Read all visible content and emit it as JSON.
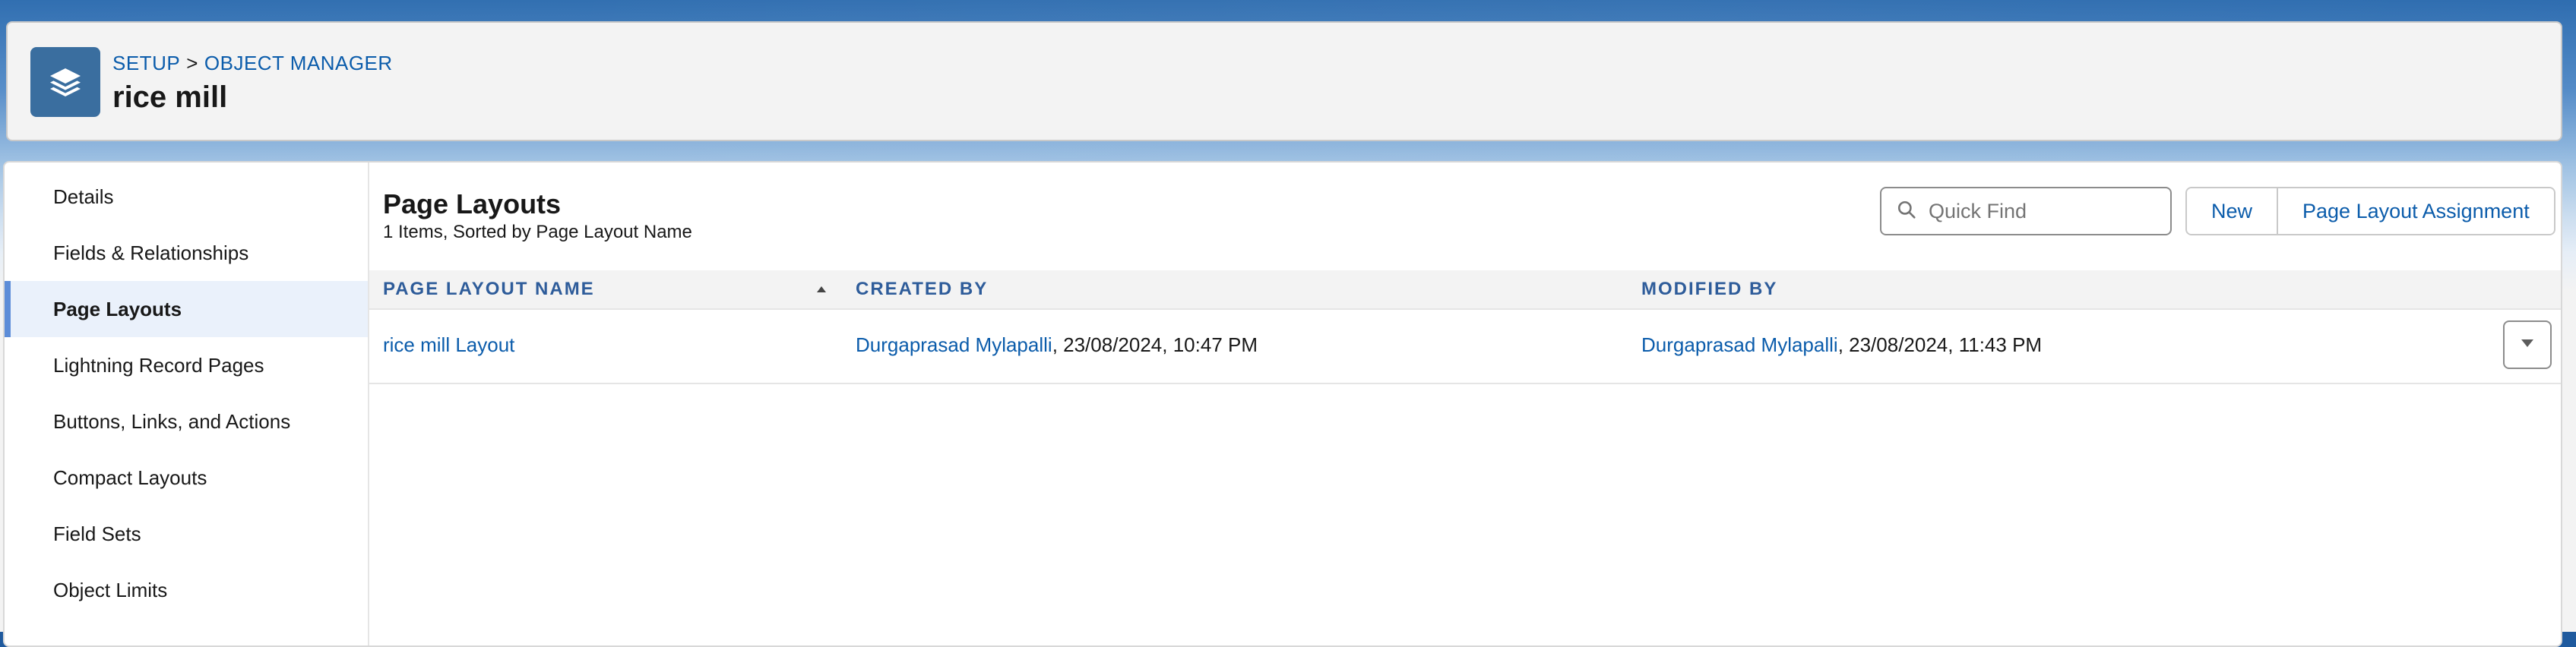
{
  "header": {
    "breadcrumb": {
      "setup": "SETUP",
      "separator": ">",
      "object_manager": "OBJECT MANAGER"
    },
    "object_name": "rice mill",
    "icon": "layers-icon",
    "icon_color": "#3a6e9f"
  },
  "sidebar": {
    "items": [
      {
        "label": "Details",
        "active": false
      },
      {
        "label": "Fields & Relationships",
        "active": false
      },
      {
        "label": "Page Layouts",
        "active": true
      },
      {
        "label": "Lightning Record Pages",
        "active": false
      },
      {
        "label": "Buttons, Links, and Actions",
        "active": false
      },
      {
        "label": "Compact Layouts",
        "active": false
      },
      {
        "label": "Field Sets",
        "active": false
      },
      {
        "label": "Object Limits",
        "active": false
      }
    ]
  },
  "main": {
    "title": "Page Layouts",
    "subtitle": "1 Items, Sorted by Page Layout Name",
    "search": {
      "placeholder": "Quick Find",
      "value": "",
      "icon": "search-icon"
    },
    "buttons": {
      "new": "New",
      "assignment": "Page Layout Assignment"
    },
    "table": {
      "columns": [
        {
          "label": "PAGE LAYOUT NAME",
          "sorted": "ascending"
        },
        {
          "label": "CREATED BY"
        },
        {
          "label": "MODIFIED BY"
        }
      ],
      "rows": [
        {
          "name": "rice mill Layout",
          "created_by_user": "Durgaprasad Mylapalli",
          "created_at": ", 23/08/2024, 10:47 PM",
          "modified_by_user": "Durgaprasad Mylapalli",
          "modified_at": ", 23/08/2024, 11:43 PM",
          "actions_icon": "chevron-down-icon"
        }
      ]
    }
  },
  "colors": {
    "link": "#0b5cab",
    "header_label": "#2e5c9a",
    "active_accent": "#5d8dd8"
  }
}
